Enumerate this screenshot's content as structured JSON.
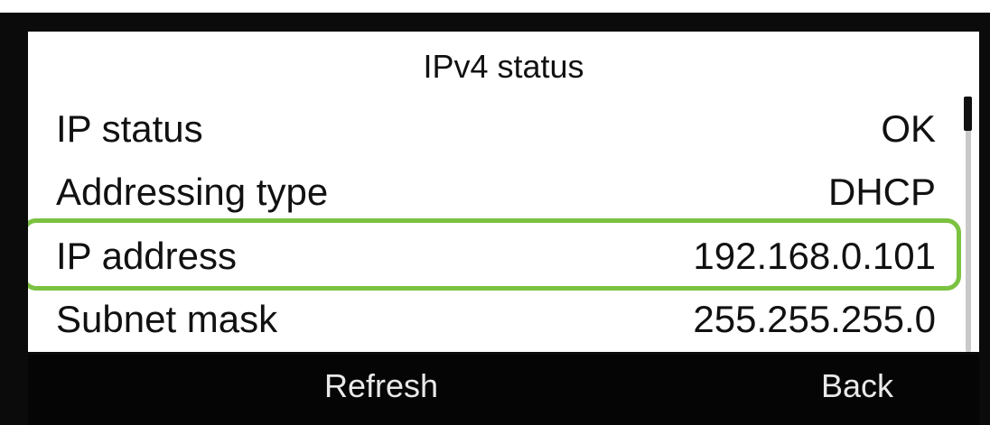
{
  "screen": {
    "title": "IPv4 status",
    "rows": [
      {
        "label": "IP status",
        "value": "OK"
      },
      {
        "label": "Addressing type",
        "value": "DHCP"
      },
      {
        "label": "IP address",
        "value": "192.168.0.101"
      },
      {
        "label": "Subnet mask",
        "value": "255.255.255.0"
      }
    ],
    "highlight_color": "#7cc242"
  },
  "softkeys": {
    "refresh_label": "Refresh",
    "back_label": "Back"
  }
}
